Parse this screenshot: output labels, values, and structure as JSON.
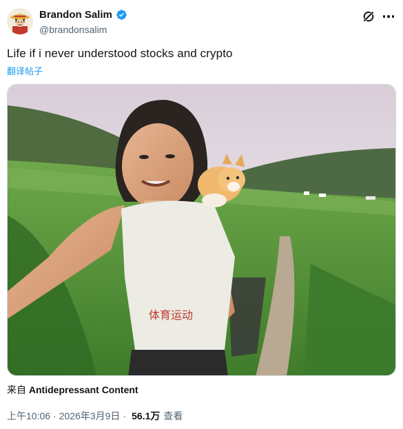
{
  "author": {
    "display_name": "Brandon Salim",
    "handle": "@brandonsalim",
    "verified": true,
    "avatar_icon": "straw-hat-avatar"
  },
  "header_actions": {
    "grok_icon": "grok-icon",
    "more_icon": "more-dots-icon"
  },
  "tweet": {
    "text": "Life if i never understood stocks and crypto",
    "translate_label": "翻译帖子"
  },
  "media": {
    "type": "video",
    "scene": "video-thumbnail"
  },
  "source": {
    "prefix": "来自",
    "app_name": "Antidepressant Content"
  },
  "meta": {
    "time": "上午10:06",
    "separator": "·",
    "date": "2026年3月9日",
    "views_count": "56.1万",
    "views_label": "查看"
  },
  "colors": {
    "accent": "#1d9bf0",
    "text_primary": "#0f1419",
    "text_secondary": "#536471",
    "border": "#cfd9de"
  }
}
